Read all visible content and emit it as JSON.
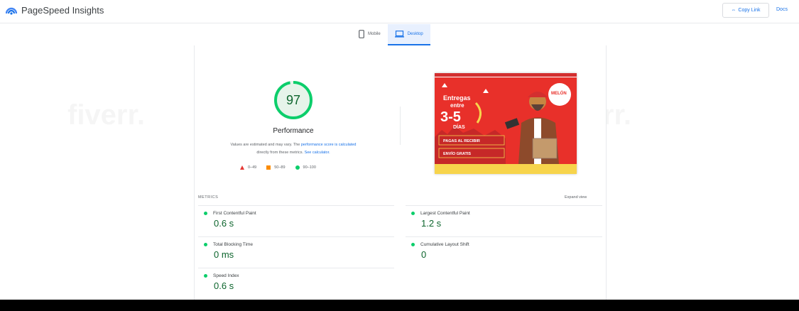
{
  "header": {
    "app_title": "PageSpeed Insights",
    "copy_link_label": "Copy Link",
    "docs_label": "Docs"
  },
  "tabs": [
    {
      "label": "Mobile",
      "active": false
    },
    {
      "label": "Desktop",
      "active": true
    }
  ],
  "summary": {
    "score": "97",
    "score_fraction": 0.97,
    "category_label": "Performance",
    "desc_prefix": "Values are estimated and may vary. The ",
    "desc_link1": "performance score is calculated",
    "desc_mid": " directly from these metrics. ",
    "desc_link2": "See calculator.",
    "legend": [
      {
        "range": "0–49",
        "color": "#e53935"
      },
      {
        "range": "50–89",
        "color": "#fb8c00"
      },
      {
        "range": "90–100",
        "color": "#0cce6b"
      }
    ]
  },
  "screenshot": {
    "heading_line1": "Entregas",
    "heading_line2": "entre",
    "days": "3-5",
    "days_label": "DÍAS",
    "brand": "MELÓN",
    "banner1": "PAGAS AL RECIBIR",
    "banner2": "ENVÍO GRATIS"
  },
  "metrics": {
    "header": "METRICS",
    "expand_label": "Expand view",
    "items": [
      {
        "name": "First Contentful Paint",
        "value": "0.6 s"
      },
      {
        "name": "Largest Contentful Paint",
        "value": "1.2 s"
      },
      {
        "name": "Total Blocking Time",
        "value": "0 ms"
      },
      {
        "name": "Cumulative Layout Shift",
        "value": "0"
      },
      {
        "name": "Speed Index",
        "value": "0.6 s"
      }
    ]
  },
  "colors": {
    "accent": "#1a73e8",
    "good": "#0cce6b",
    "good_text": "#0d652d",
    "screenshot_red": "#e8302a"
  },
  "watermark": "fiverr."
}
